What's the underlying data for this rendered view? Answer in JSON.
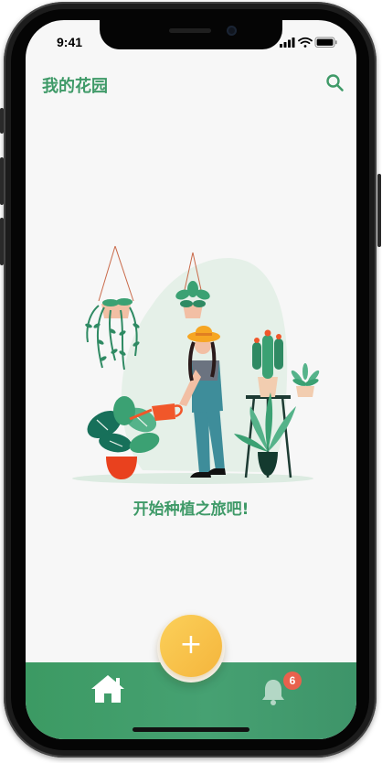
{
  "status_bar": {
    "time": "9:41"
  },
  "header": {
    "title": "我的花园",
    "search_icon": "search-icon"
  },
  "main": {
    "cta_text": "开始种植之旅吧!"
  },
  "fab": {
    "label": "+",
    "icon": "plus-icon"
  },
  "tabbar": {
    "home_icon": "home-icon",
    "bell_icon": "bell-icon",
    "notification_count": "6"
  },
  "colors": {
    "brand_green": "#3f9a68",
    "fab_yellow": "#f8c148",
    "badge_red": "#e9614d",
    "background": "#f7f7f7"
  }
}
